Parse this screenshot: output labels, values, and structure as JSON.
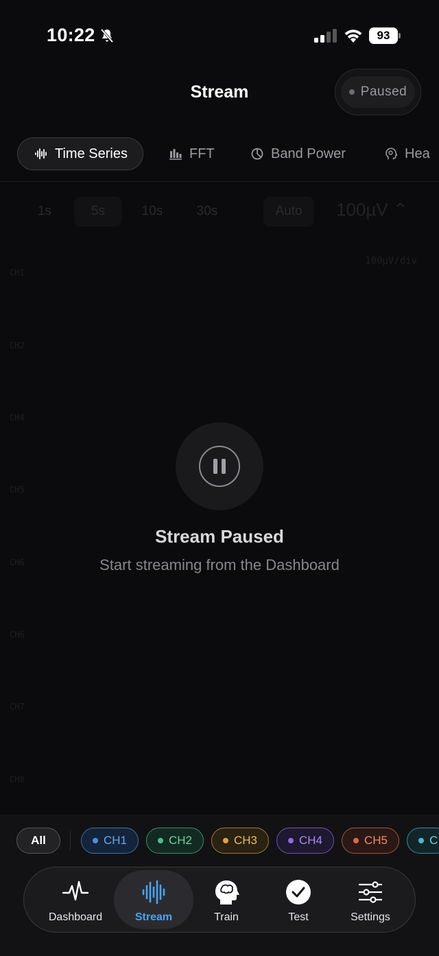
{
  "status_bar": {
    "time": "10:22",
    "battery": "93"
  },
  "header": {
    "title": "Stream",
    "status_label": "Paused"
  },
  "tabs": [
    {
      "label": "Time Series",
      "icon": "waveform-icon"
    },
    {
      "label": "FFT",
      "icon": "bar-chart-icon"
    },
    {
      "label": "Band Power",
      "icon": "pie-chart-icon"
    },
    {
      "label": "Hea",
      "icon": "head-icon"
    }
  ],
  "controls": {
    "windows": [
      "1s",
      "5s",
      "10s",
      "30s"
    ],
    "auto": "Auto",
    "scale": "100µV ⌃",
    "per_div": "100µV/div"
  },
  "channels": [
    "CH1",
    "CH2",
    "CH4",
    "CH5",
    "CH6",
    "CH6",
    "CH7",
    "CH8"
  ],
  "paused": {
    "title": "Stream Paused",
    "subtitle": "Start streaming from the Dashboard"
  },
  "chips": {
    "all": "All",
    "items": [
      {
        "label": "CH1",
        "color": "#4a8fe0"
      },
      {
        "label": "CH2",
        "color": "#4cc08d"
      },
      {
        "label": "CH3",
        "color": "#e0a53a"
      },
      {
        "label": "CH4",
        "color": "#8c6be8"
      },
      {
        "label": "CH5",
        "color": "#e0664a"
      },
      {
        "label": "C",
        "color": "#4fb8c8"
      }
    ]
  },
  "nav": [
    {
      "label": "Dashboard",
      "icon": "pulse-icon"
    },
    {
      "label": "Stream",
      "icon": "waveform-icon"
    },
    {
      "label": "Train",
      "icon": "brain-head-icon"
    },
    {
      "label": "Test",
      "icon": "checkmark-circle-icon"
    },
    {
      "label": "Settings",
      "icon": "sliders-icon"
    }
  ]
}
